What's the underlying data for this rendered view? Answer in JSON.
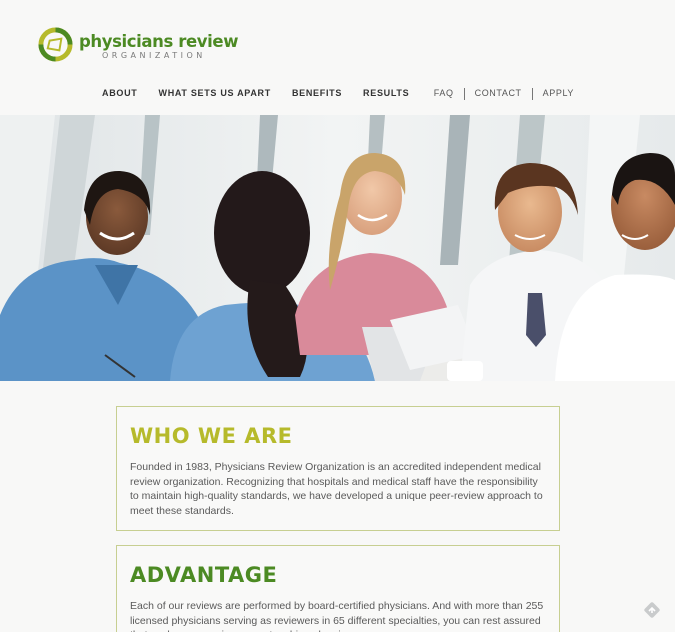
{
  "brand": {
    "name": "physicians review",
    "subtitle": "ORGANIZATION",
    "colors": {
      "green": "#4c8a23",
      "lime": "#b6ba2b",
      "border": "#c7cf91"
    }
  },
  "nav": {
    "main": [
      "ABOUT",
      "WHAT SETS US APART",
      "BENEFITS",
      "RESULTS"
    ],
    "utility": [
      "FAQ",
      "CONTACT",
      "APPLY"
    ]
  },
  "sections": {
    "who": {
      "title": "WHO WE ARE",
      "body": "Founded in 1983, Physicians Review Organization is an accredited independent medical review organization. Recognizing that hospitals and medical staff have the responsibility to maintain high-quality standards, we have developed a unique peer-review approach to meet these standards."
    },
    "advantage": {
      "title": "ADVANTAGE",
      "body": "Each of our reviews are performed by board-certified physicians. And with more than 255 licensed physicians serving as reviewers in 65 different specialties, you can rest assured that each case receives expert, unbiased review."
    }
  },
  "icons": {
    "logo": "logo-ring-icon",
    "corner": "diamond-arrow-icon"
  }
}
